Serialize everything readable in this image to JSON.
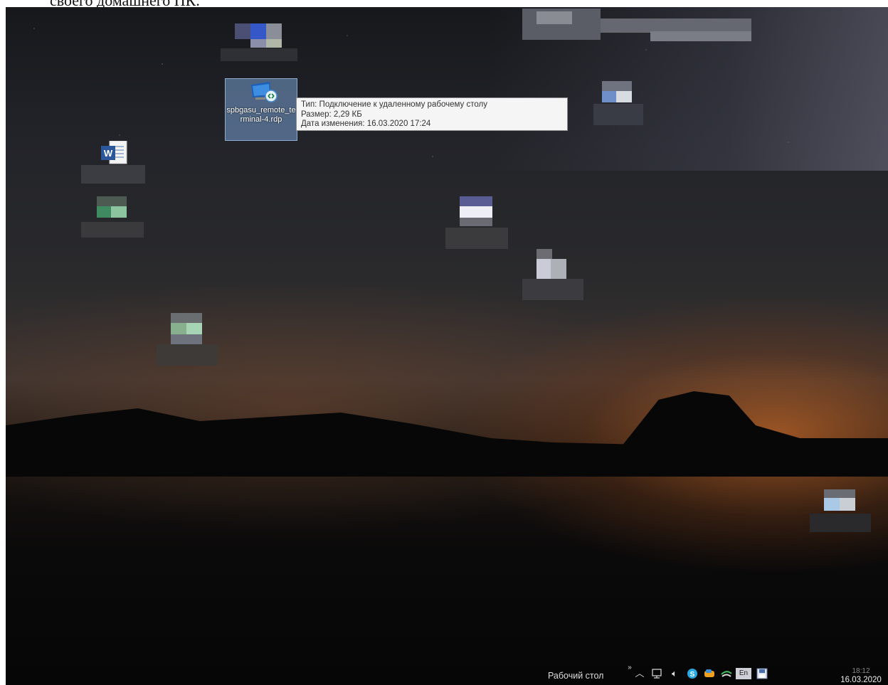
{
  "document": {
    "caption": "своего домашнего ПК."
  },
  "desktop": {
    "rdp_icon": {
      "name": "spbgasu_remote_terminal-4.rdp",
      "icon": "remote-desktop-icon"
    },
    "tooltip": {
      "type_line": "Тип: Подключение к удаленному рабочему столу",
      "size_line": "Размер: 2,29 КБ",
      "modified_line": "Дата изменения: 16.03.2020 17:24"
    },
    "word_icon": {
      "icon": "word-document-icon"
    }
  },
  "taskbar": {
    "desktop_toolbar_label": "Рабочий стол",
    "language": "En",
    "time": "18:12",
    "date": "16.03.2020",
    "icons": [
      "chevron-up-icon",
      "network-icon",
      "volume-icon",
      "skype-icon",
      "cloud-icon",
      "sync-icon",
      "keyboard-layout-icon",
      "save-icon"
    ]
  }
}
